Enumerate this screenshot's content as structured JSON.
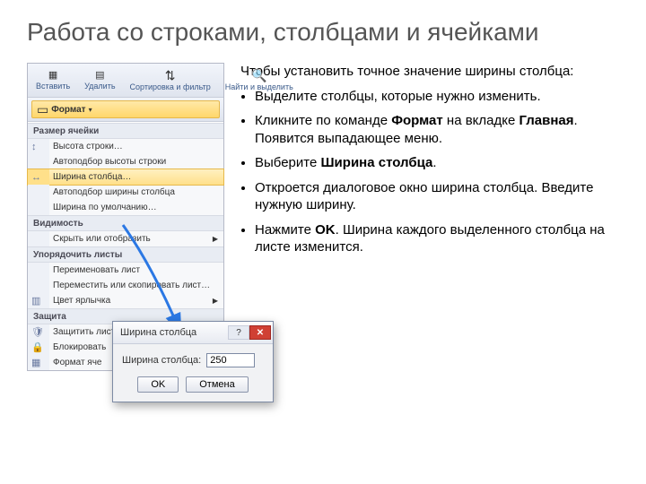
{
  "title": "Работа со строками, столбцами и ячейками",
  "intro": "Чтобы установить точное значение ширины столбца:",
  "bullets": [
    "Выделите столбцы, которые нужно изменить.",
    "Кликните по команде <b>Формат</b> на вкладке <b>Главная</b>. Появится выпадающее меню.",
    "Выберите <b>Ширина столбца</b>.",
    "Откроется диалоговое окно ширина столбца. Введите нужную ширину.",
    "Нажмите <b>OK</b>. Ширина каждого выделенного столбца на листе изменится."
  ],
  "ribbon": {
    "insert": "Вставить",
    "delete": "Удалить",
    "format": "Формат",
    "sort": "Сортировка и фильтр",
    "find": "Найти и выделить"
  },
  "menu": {
    "section_size": "Размер ячейки",
    "row_height": "Высота строки…",
    "autofit_row": "Автоподбор высоты строки",
    "col_width": "Ширина столбца…",
    "autofit_col": "Автоподбор ширины столбца",
    "default_width": "Ширина по умолчанию…",
    "section_vis": "Видимость",
    "hide": "Скрыть или отобразить",
    "section_order": "Упорядочить листы",
    "rename": "Переименовать лист",
    "move": "Переместить или скопировать лист…",
    "tab_color": "Цвет ярлычка",
    "section_protect": "Защита",
    "protect_sheet": "Защитить лист…",
    "lock": "Блокировать",
    "format_cell": "Формат яче"
  },
  "dialog": {
    "title": "Ширина столбца",
    "label": "Ширина столбца:",
    "value": "250",
    "ok": "OK",
    "cancel": "Отмена"
  }
}
